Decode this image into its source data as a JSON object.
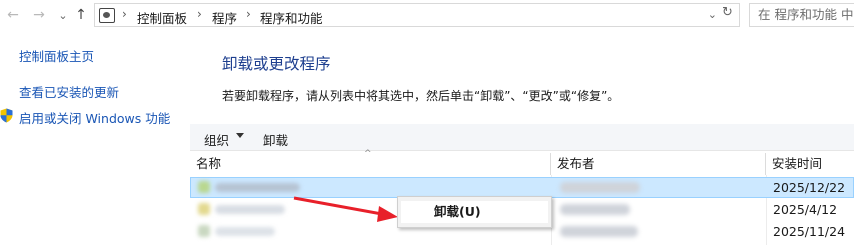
{
  "address_bar": {
    "back": "←",
    "forward": "→",
    "recent": "⌄",
    "up": "↑",
    "breadcrumbs": [
      "控制面板",
      "程序",
      "程序和功能"
    ],
    "separator": "›",
    "dropdown": "⌄",
    "refresh": "↻",
    "search_placeholder": "在 程序和功能 中搜索"
  },
  "sidebar": {
    "items": [
      {
        "label": "控制面板主页"
      },
      {
        "label": "查看已安装的更新"
      },
      {
        "label": "启用或关闭 Windows 功能",
        "icon": "shield-icon"
      }
    ]
  },
  "main": {
    "title": "卸载或更改程序",
    "description": "若要卸载程序，请从列表中将其选中，然后单击“卸载”、“更改”或“修复”。"
  },
  "toolbar": {
    "organize_label": "组织",
    "uninstall_label": "卸载"
  },
  "table": {
    "sort_indicator": "^",
    "columns": [
      "名称",
      "发布者",
      "安装时间"
    ],
    "rows": [
      {
        "install_date": "2025/12/22",
        "selected": true
      },
      {
        "install_date": "2025/4/12",
        "selected": false
      },
      {
        "install_date": "2025/11/24",
        "selected": false
      }
    ]
  },
  "context_menu": {
    "items": [
      {
        "label": "卸载(U)"
      }
    ]
  },
  "colors": {
    "link": "#1a56b5",
    "heading": "#1e3f8f",
    "selection": "#cce8ff",
    "annotation_arrow": "#e8202a"
  }
}
